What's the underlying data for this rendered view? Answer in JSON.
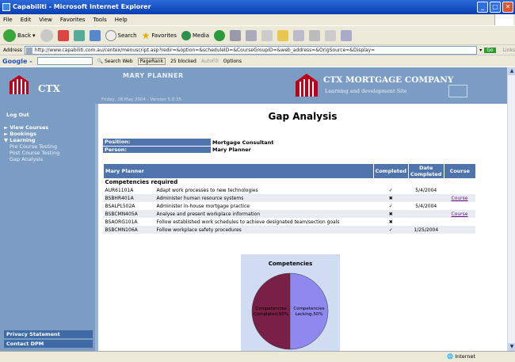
{
  "window": {
    "title": "Capabiliti - Microsoft Internet Explorer"
  },
  "menu": [
    "File",
    "Edit",
    "View",
    "Favorites",
    "Tools",
    "Help"
  ],
  "toolbar": {
    "back": "Back",
    "search": "Search",
    "favorites": "Favorites",
    "media": "Media"
  },
  "address": {
    "label": "Address",
    "url": "http://www.capabiliti.com.au/centex/menuscript.asp?redir=&option=&scheduleID=&CourseGroupID=&web_address=&OrigSource=&Display=",
    "go": "Go",
    "links": "Links"
  },
  "google": {
    "label": "Google -",
    "search_web": "Search Web",
    "pagerank": "PageRank",
    "blocked": "25 blocked",
    "autofill": "AutoFill",
    "options": "Options"
  },
  "header": {
    "brand": "CTX",
    "user": "MARY PLANNER",
    "date_version": "Friday, 28 May 2004 - Version 5.0.35",
    "company": "CTX MORTGAGE COMPANY",
    "site": "Learning and development Site"
  },
  "sidebar": {
    "logout": "Log Out",
    "items": [
      {
        "label": "► View Courses"
      },
      {
        "label": "► Bookings"
      },
      {
        "label": "▼ Learning"
      }
    ],
    "subitems": [
      {
        "label": "Pre Course Testing"
      },
      {
        "label": "Post Course Testing"
      },
      {
        "label": "Gap Analysis"
      }
    ],
    "privacy": "Privacy Statement",
    "contact": "Contact DPM"
  },
  "content": {
    "title": "Gap Analysis",
    "position_label": "Position:",
    "position_value": "Mortgage Consultant",
    "person_label": "Person:",
    "person_value": "Mary Planner"
  },
  "table": {
    "headers": {
      "name": "Mary Planner",
      "completed": "Completed",
      "date": "Date Completed",
      "course": "Course"
    },
    "section": "Competencies required",
    "rows": [
      {
        "code": "AUR61101A",
        "desc": "Adapt work processes to new technologies",
        "completed": "✓",
        "date": "5/4/2004",
        "course": ""
      },
      {
        "code": "BSBHR401A",
        "desc": "Administer human resource systems",
        "completed": "✖",
        "date": "",
        "course": "Course"
      },
      {
        "code": "BSALPL502A",
        "desc": "Administer in-house mortgage practice",
        "completed": "✓",
        "date": "5/4/2004",
        "course": ""
      },
      {
        "code": "BSBCMN405A",
        "desc": "Analyse and present workplace information",
        "completed": "✖",
        "date": "",
        "course": "Course"
      },
      {
        "code": "BSAORG101A",
        "desc": "Follow established work schedules to achieve designated team/section goals",
        "completed": "✖",
        "date": "",
        "course": ""
      },
      {
        "code": "BSBCMN106A",
        "desc": "Follow workplace safety procedures",
        "completed": "✓",
        "date": "1/25/2004",
        "course": ""
      }
    ]
  },
  "chart_data": {
    "type": "pie",
    "title": "Competencies",
    "slices": [
      {
        "label": "Competencies Completed,50%",
        "value": 50,
        "color": "#7a2046"
      },
      {
        "label": "Competencies Lacking,50%",
        "value": 50,
        "color": "#8f88ef"
      }
    ]
  },
  "status": {
    "zone": "Internet"
  }
}
